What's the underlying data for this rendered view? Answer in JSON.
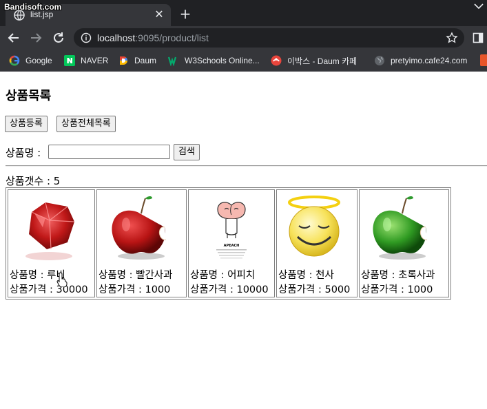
{
  "watermark": "Bandisoft.com",
  "tab": {
    "title": "list.jsp"
  },
  "address": {
    "host": "localhost",
    "rest": ":9095/product/list"
  },
  "bookmarks": [
    {
      "label": "Google",
      "icon": "google-icon"
    },
    {
      "label": "NAVER",
      "icon": "naver-icon"
    },
    {
      "label": "Daum",
      "icon": "daum-icon"
    },
    {
      "label": "W3Schools Online...",
      "icon": "w3schools-icon"
    },
    {
      "label": "이박스 - Daum 카페",
      "icon": "daum-cafe-icon"
    },
    {
      "label": "pretyimo.cafe24.com",
      "icon": "globe-icon"
    }
  ],
  "page": {
    "title": "상품목록",
    "register_button": "상품등록",
    "list_all_button": "상품전체목록",
    "search_label": "상품명 :",
    "search_value": "",
    "search_button": "검색",
    "count_text": "상품갯수 : 5"
  },
  "products": [
    {
      "name": "상품명 : 루비",
      "price": "상품가격 : 30000",
      "image": "ruby-gem-image"
    },
    {
      "name": "상품명 : 빨간사과",
      "price": "상품가격 : 1000",
      "image": "red-apple-image"
    },
    {
      "name": "상품명 : 어피치",
      "price": "상품가격 : 10000",
      "image": "apeach-image",
      "image_caption": "APEACH"
    },
    {
      "name": "상품명 : 천사",
      "price": "상품가격 : 5000",
      "image": "angel-face-image"
    },
    {
      "name": "상품명 : 초록사과",
      "price": "상품가격 : 1000",
      "image": "green-apple-image"
    }
  ],
  "colors": {
    "chrome_dark": "#202124",
    "chrome_toolbar": "#35363a",
    "chrome_text": "#e8eaed"
  }
}
